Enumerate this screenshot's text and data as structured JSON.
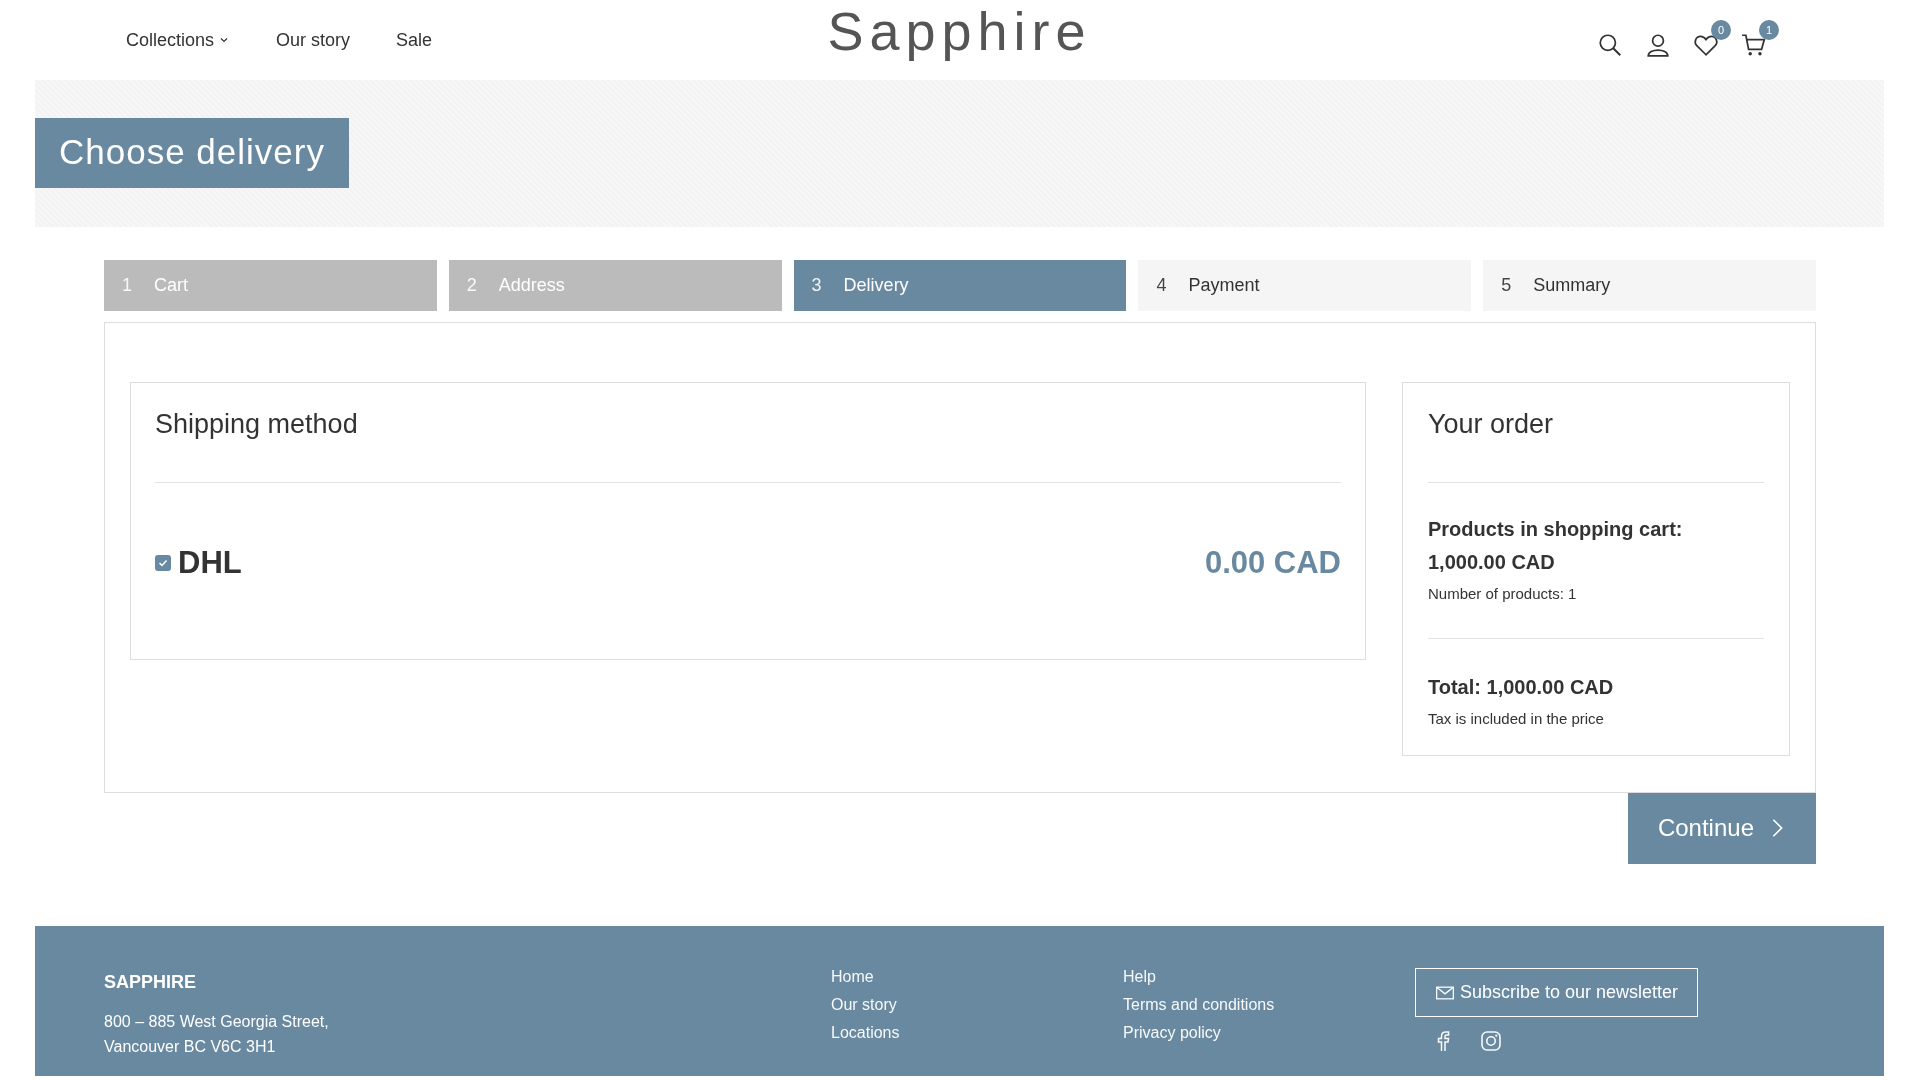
{
  "header": {
    "nav": [
      {
        "label": "Collections",
        "dropdown": true
      },
      {
        "label": "Our story",
        "dropdown": false
      },
      {
        "label": "Sale",
        "dropdown": false
      }
    ],
    "logo": "Sapphire",
    "icons": [
      {
        "kind": "search"
      },
      {
        "kind": "account"
      },
      {
        "kind": "wishlist",
        "badge": "0"
      },
      {
        "kind": "cart",
        "badge": "1"
      }
    ]
  },
  "page_title": "Choose delivery",
  "steps": [
    {
      "number": "1",
      "label": "Cart",
      "completed": true,
      "selected": false
    },
    {
      "number": "2",
      "label": "Address",
      "completed": true,
      "selected": false
    },
    {
      "number": "3",
      "label": "Delivery",
      "completed": false,
      "selected": true
    },
    {
      "number": "4",
      "label": "Payment",
      "completed": false,
      "selected": false
    },
    {
      "number": "5",
      "label": "Summary",
      "completed": false,
      "selected": false
    }
  ],
  "shipping": {
    "title": "Shipping method",
    "options": [
      {
        "name": "DHL",
        "price": "0.00 CAD",
        "checked": true
      }
    ]
  },
  "order": {
    "title": "Your order",
    "products_label": "Products in shopping cart:",
    "products_total": "1,000.00 CAD",
    "count": "Number of products: 1",
    "total": "Total: 1,000.00 CAD",
    "tax_note": "Tax is included in the price"
  },
  "continue_button": "Continue",
  "footer": {
    "brand": "SAPPHIRE",
    "address": [
      "800 – 885 West Georgia Street,",
      "Vancouver BC V6C 3H1"
    ],
    "links_1": [
      "Home",
      "Our story",
      "Locations"
    ],
    "links_2": [
      "Help",
      "Terms and conditions",
      "Privacy policy"
    ],
    "newsletter_button": "Subscribe to our newsletter",
    "social": [
      {
        "kind": "facebook"
      },
      {
        "kind": "instagram"
      }
    ]
  }
}
